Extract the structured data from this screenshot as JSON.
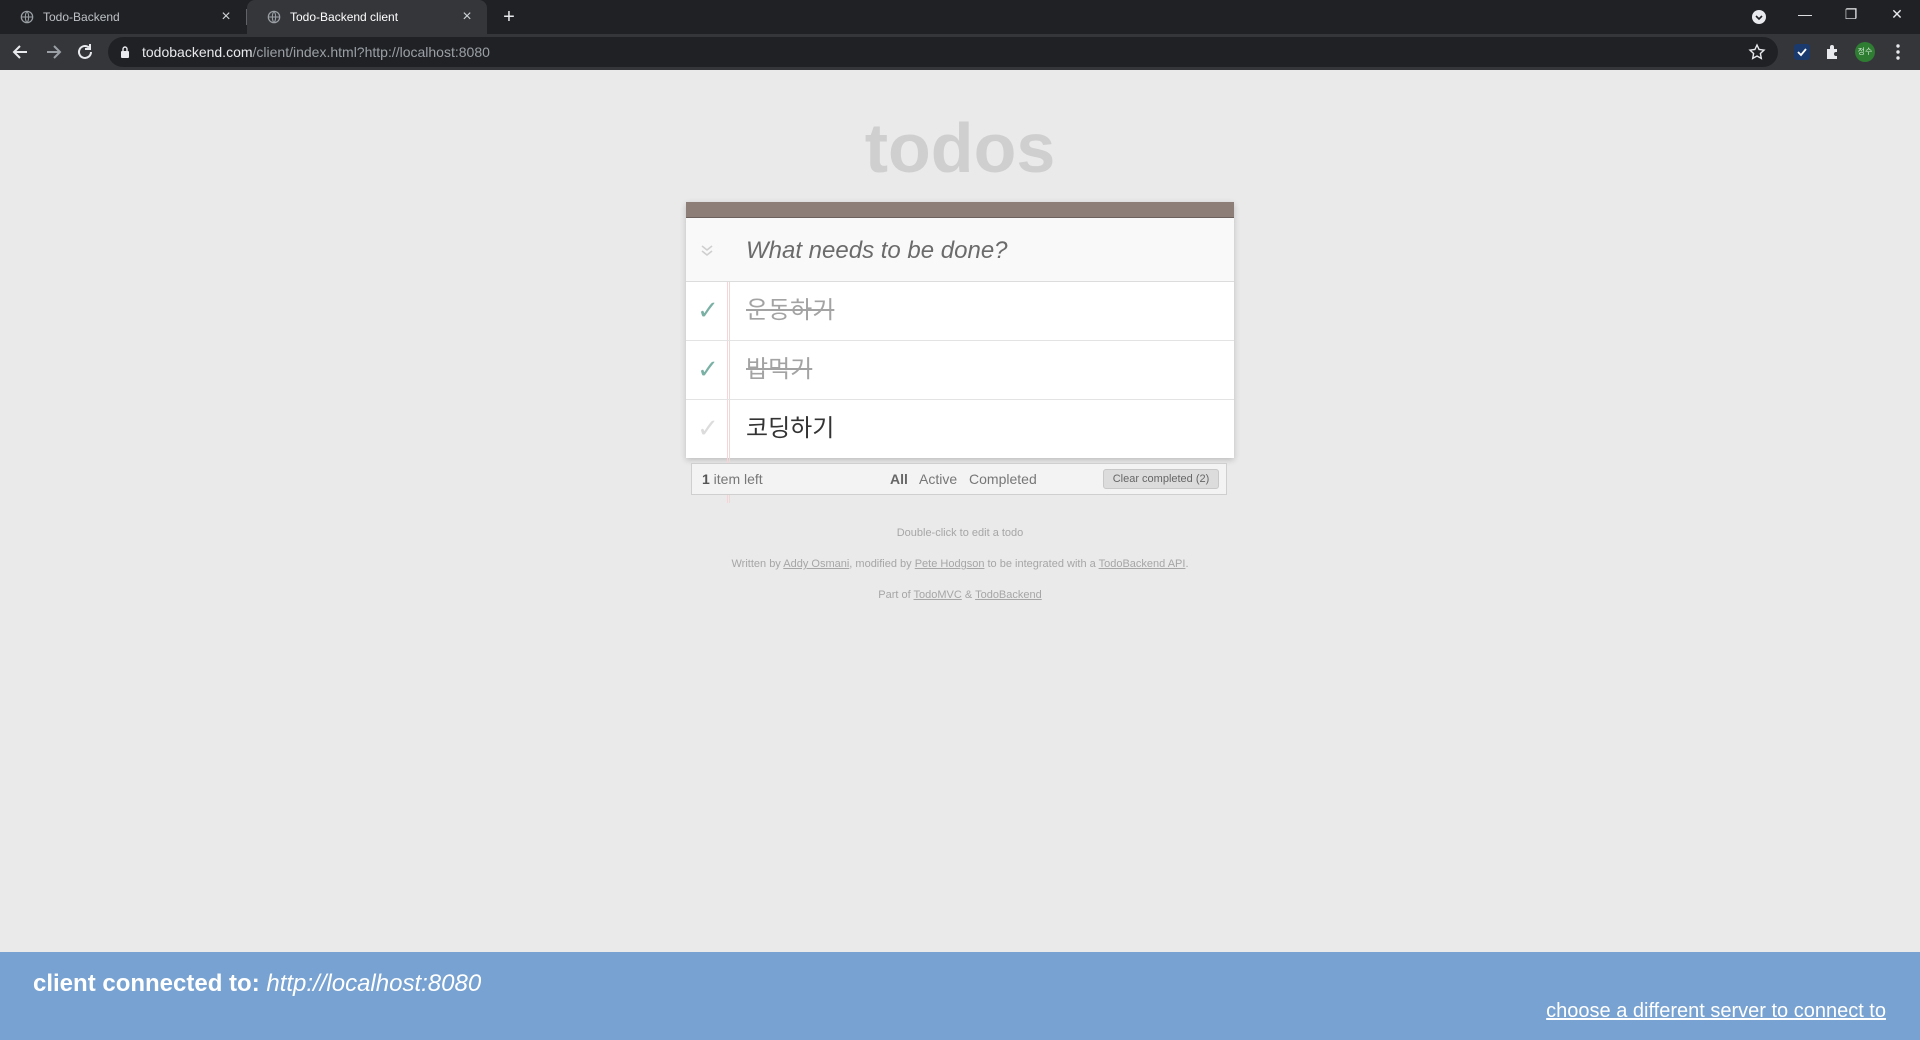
{
  "browser": {
    "tabs": [
      {
        "title": "Todo-Backend",
        "active": false
      },
      {
        "title": "Todo-Backend client",
        "active": true
      }
    ],
    "url_host": "todobackend.com",
    "url_path": "/client/index.html?http://localhost:8080",
    "profile_initials": "정수"
  },
  "app": {
    "title": "todos",
    "new_todo_placeholder": "What needs to be done?",
    "todos": [
      {
        "text": "운동하기",
        "completed": true
      },
      {
        "text": "밥먹기",
        "completed": true
      },
      {
        "text": "코딩하기",
        "completed": false
      }
    ],
    "footer": {
      "count": "1",
      "count_suffix": " item left",
      "filters": [
        "All",
        "Active",
        "Completed"
      ],
      "selected_filter": "All",
      "clear_label": "Clear completed (2)"
    }
  },
  "info": {
    "hint": "Double-click to edit a todo",
    "written_by": "Written by ",
    "author1": "Addy Osmani",
    "modified_by": ", modified by ",
    "author2": "Pete Hodgson",
    "integrated": " to be integrated with a ",
    "api_link": "TodoBackend API",
    "period": ".",
    "part_of": "Part of ",
    "todomvc": "TodoMVC",
    "amp": " & ",
    "todobackend": "TodoBackend"
  },
  "connection": {
    "label": "client connected to:",
    "server": "http://localhost:8080",
    "change_link": "choose a different server to connect to"
  },
  "colors": {
    "bottom_bar": "#77a2d1",
    "check_done": "#7bb0a4",
    "header_strip": "#8d7f77"
  }
}
